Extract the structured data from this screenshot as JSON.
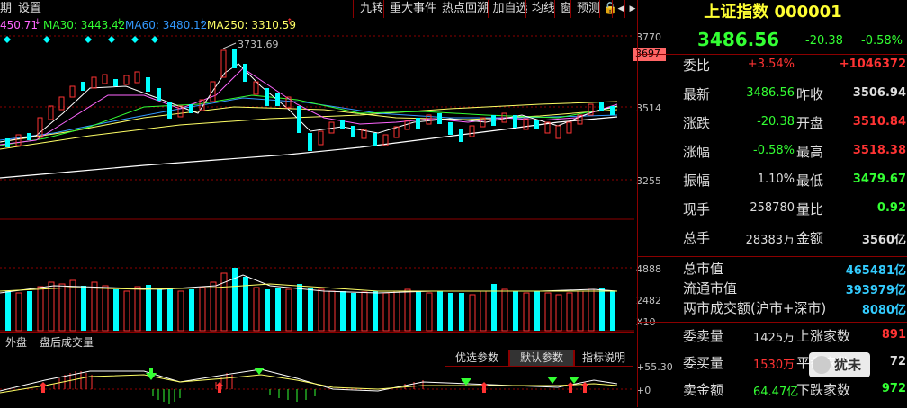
{
  "menu": {
    "period": "期",
    "settings": "设置",
    "buttons": [
      "九转",
      "重大事件",
      "热点回溯",
      "加自选",
      "均线",
      "窗",
      "预测"
    ],
    "lock": "🔒",
    "back": "◀",
    "forward": "▶"
  },
  "ma_legend": {
    "ma_prefix": "450.71",
    "ma30": "MA30: 3443.42",
    "ma60": "MA60: 3480.12",
    "ma250": "MA250: 3310.59"
  },
  "price_axis": {
    "p3770": "3770",
    "p3697": "3697",
    "p3514": "3514",
    "p3255": "3255",
    "high_label": "3731.69"
  },
  "volume_axis": {
    "v4888": "4888",
    "v2482": "2482",
    "unit": "X10"
  },
  "tabs": {
    "outer": "外盘",
    "after": "盘后成交量"
  },
  "indicator_buttons": [
    "优选参数",
    "默认参数",
    "指标说明"
  ],
  "indicator_axis": {
    "top": "+55.30",
    "zero": "+0"
  },
  "quote": {
    "title": "上证指数 000001",
    "price": "3486.56",
    "change": "-20.38",
    "change_pct": "-0.58%"
  },
  "rows": [
    {
      "l1": "委比",
      "v1": "+3.54%",
      "c1": "#ff3333",
      "l2": "",
      "v2": "+1046372",
      "c2": "#ff3333"
    },
    {
      "l1": "最新",
      "v1": "3486.56",
      "c1": "#33ff33",
      "l2": "昨收",
      "v2": "3506.94",
      "c2": "#dddddd"
    },
    {
      "l1": "涨跌",
      "v1": "-20.38",
      "c1": "#33ff33",
      "l2": "开盘",
      "v2": "3510.84",
      "c2": "#ff3333"
    },
    {
      "l1": "涨幅",
      "v1": "-0.58%",
      "c1": "#33ff33",
      "l2": "最高",
      "v2": "3518.38",
      "c2": "#ff3333"
    },
    {
      "l1": "振幅",
      "v1": "1.10%",
      "c1": "#dddddd",
      "l2": "最低",
      "v2": "3479.67",
      "c2": "#33ff33"
    },
    {
      "l1": "现手",
      "v1": "258780",
      "c1": "#dddddd",
      "l2": "量比",
      "v2": "0.92",
      "c2": "#33ff33"
    },
    {
      "l1": "总手",
      "v1": "28383万",
      "c1": "#dddddd",
      "l2": "金额",
      "v2": "3560亿",
      "c2": "#dddddd"
    }
  ],
  "cap_rows": [
    {
      "label": "总市值",
      "value": "465481亿"
    },
    {
      "label": "流通市值",
      "value": "393979亿"
    },
    {
      "label": "两市成交额(沪市+深市)",
      "value": "8080亿"
    }
  ],
  "bottom_rows": [
    {
      "l1": "委卖量",
      "v1": "1425万",
      "c1": "#dddddd",
      "l2": "上涨家数",
      "v2": "891",
      "c2": "#ff3333"
    },
    {
      "l1": "委买量",
      "v1": "1530万",
      "c1": "#ff3333",
      "l2": "平盘家数",
      "v2": "72",
      "c2": "#dddddd"
    },
    {
      "l1": "卖金额",
      "v1": "64.47亿",
      "c1": "#33ff33",
      "l2": "下跌家数",
      "v2": "972",
      "c2": "#33ff33"
    }
  ],
  "watermark": "犹未",
  "colors": {
    "up": "#ff3333",
    "down": "#00ffff",
    "grid": "#8b0000",
    "yellow": "#ffff00"
  }
}
